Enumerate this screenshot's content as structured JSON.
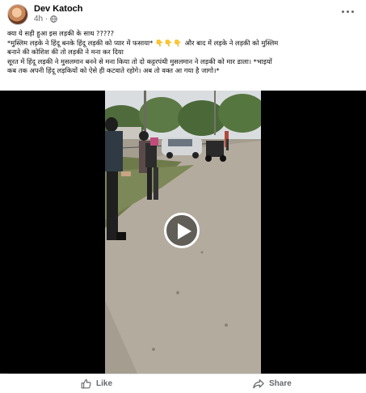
{
  "post": {
    "author": "Dev Katoch",
    "timestamp": "4h ·",
    "privacy_icon": "globe-icon",
    "more_icon": "more-options-icon",
    "text_lines": [
      "क्या ये सही हुआ इस लड़की के साथ ?????",
      "*मुस्लिम लड़के ने हिंदू बनके हिंदू लड़की को प्यार में फसाया*",
      "और बाद में लड़के ने लड़की को मुस्लिम",
      "बनाने की कोशिश की तो लड़की ने मना कर दिया",
      "सूरत में हिंदू लड़की ने मुसलमान बनने से मना किया तो दो कट्टरपंथी मुसलमान ने लड़की को मार डाला। *भाइयों",
      "कब तक अपनी हिंदू लड़कियों को ऐसे ही कटवाते रहोगे। अब तो वक्त आ गया है जागो।*"
    ],
    "emoji": "👇👇👇",
    "video": {
      "play_icon": "play-icon"
    },
    "actions": {
      "like_label": "Like",
      "like_icon": "thumbs-up-icon",
      "share_label": "Share",
      "share_icon": "share-arrow-icon"
    }
  }
}
